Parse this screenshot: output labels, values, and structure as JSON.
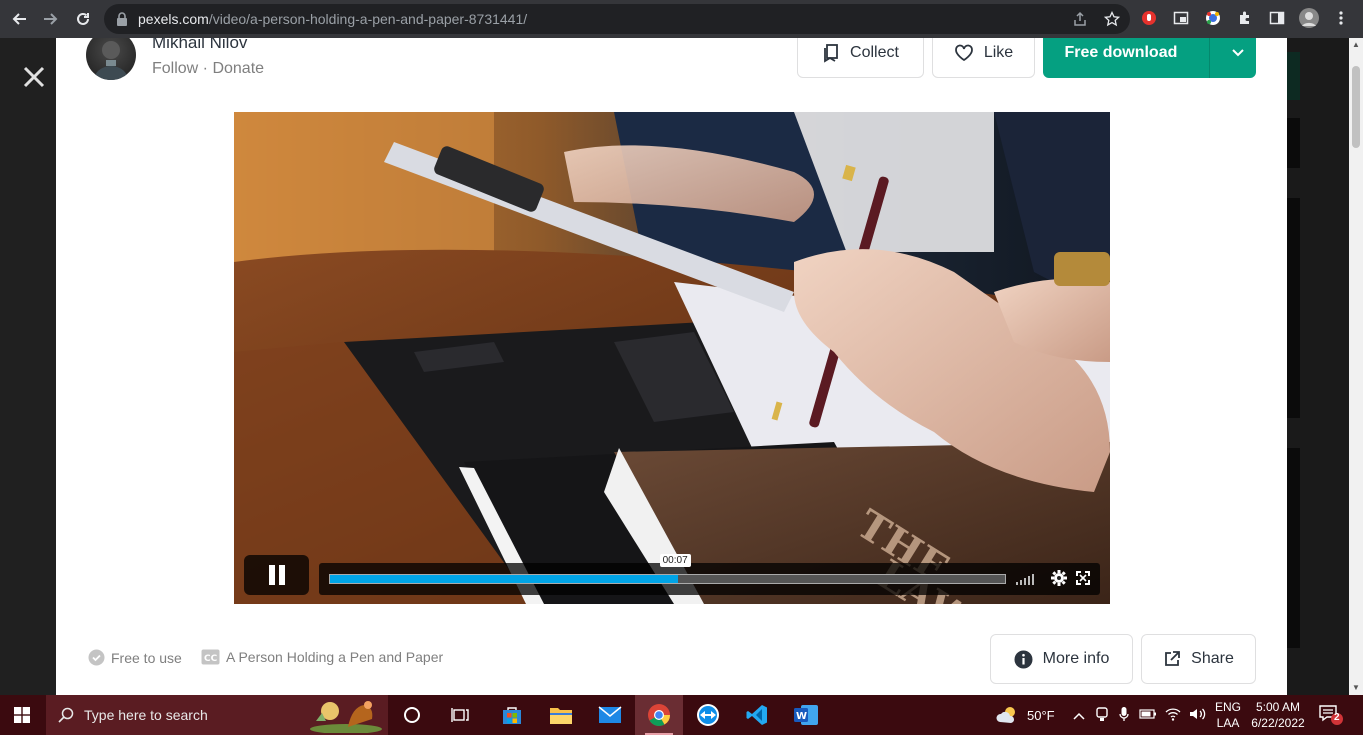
{
  "browser": {
    "url_host": "pexels.com",
    "url_path": "/video/a-person-holding-a-pen-and-paper-8731441/"
  },
  "author": {
    "name": "Mikhail Nilov",
    "links": "Follow · Donate"
  },
  "actions": {
    "collect_label": "Collect",
    "like_label": "Like",
    "download_label": "Free download"
  },
  "player": {
    "time_tooltip": "00:07",
    "progress": 0.515
  },
  "meta": {
    "license_label": "Free to use",
    "caption_label": "A Person Holding a Pen and Paper"
  },
  "footer_actions": {
    "more_info_label": "More info",
    "share_label": "Share"
  },
  "taskbar": {
    "search_placeholder": "Type here to search",
    "weather_temp": "50°F",
    "lang_line1": "ENG",
    "lang_line2": "LAA",
    "time": "5:00 AM",
    "date": "6/22/2022",
    "notification_count": "2"
  },
  "colors": {
    "brand_green": "#05a081",
    "progress_blue": "#00a4e6",
    "taskbar_bg": "#3b0a0f"
  }
}
